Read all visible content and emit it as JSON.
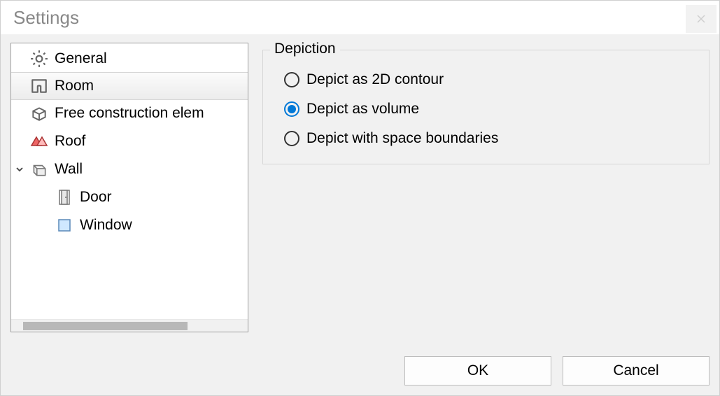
{
  "window": {
    "title": "Settings"
  },
  "tree": {
    "items": [
      {
        "label": "General"
      },
      {
        "label": "Room"
      },
      {
        "label": "Free construction elem"
      },
      {
        "label": "Roof"
      },
      {
        "label": "Wall"
      },
      {
        "label": "Door"
      },
      {
        "label": "Window"
      }
    ]
  },
  "group": {
    "title": "Depiction"
  },
  "radios": {
    "opt0": "Depict as 2D contour",
    "opt1": "Depict as volume",
    "opt2": "Depict with space boundaries"
  },
  "buttons": {
    "ok": "OK",
    "cancel": "Cancel"
  }
}
